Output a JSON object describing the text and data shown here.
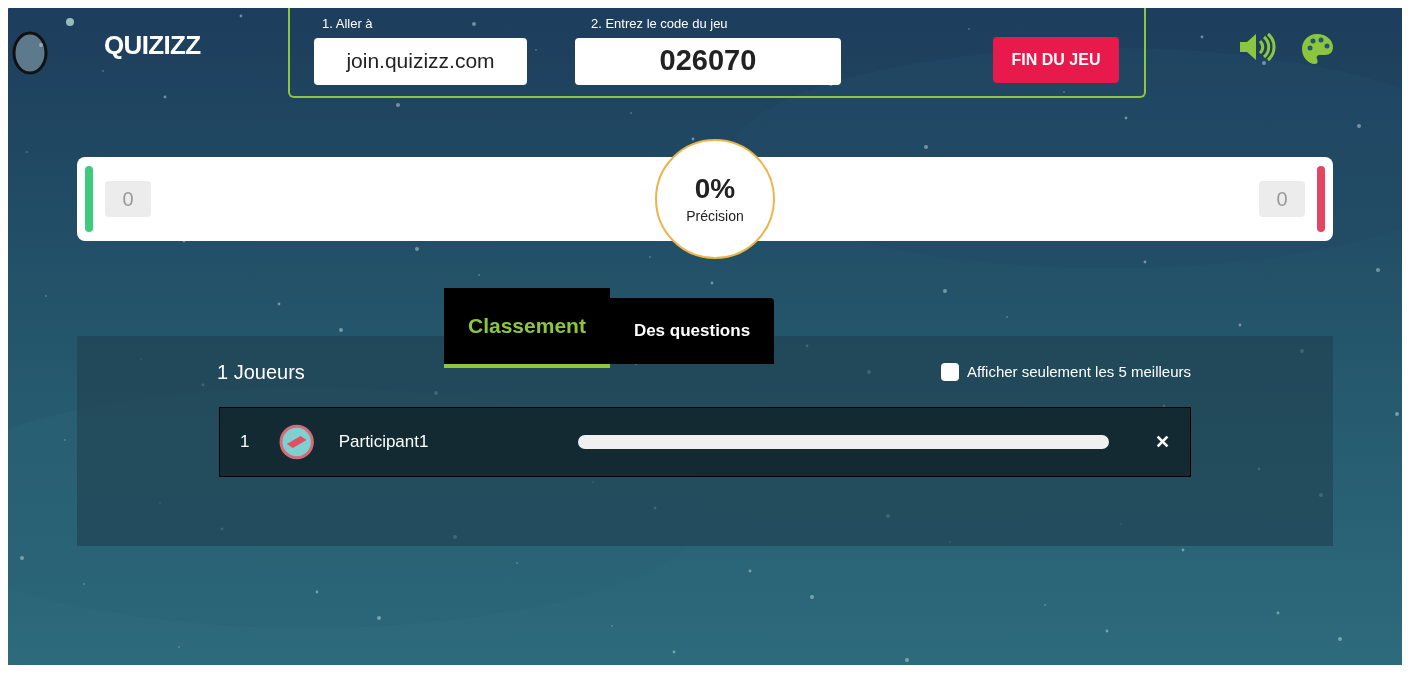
{
  "header": {
    "logo": "QUIZIZZ",
    "join": {
      "label": "1. Aller à",
      "value": "join.quizizz.com"
    },
    "code": {
      "label": "2. Entrez le code du jeu",
      "value": "026070"
    },
    "end_button": "FIN DU JEU"
  },
  "accuracy": {
    "correct": "0",
    "incorrect": "0",
    "percent": "0%",
    "label": "Précision"
  },
  "tabs": [
    {
      "label": "Classement",
      "selected": true
    },
    {
      "label": "Des questions",
      "selected": false
    }
  ],
  "leaderboard": {
    "count": "1 Joueurs",
    "top_filter": {
      "label": "Afficher seulement les 5 meilleurs",
      "checked": false
    },
    "players": [
      {
        "rank": "1",
        "name": "Participant1",
        "remove": "✕"
      }
    ]
  }
}
